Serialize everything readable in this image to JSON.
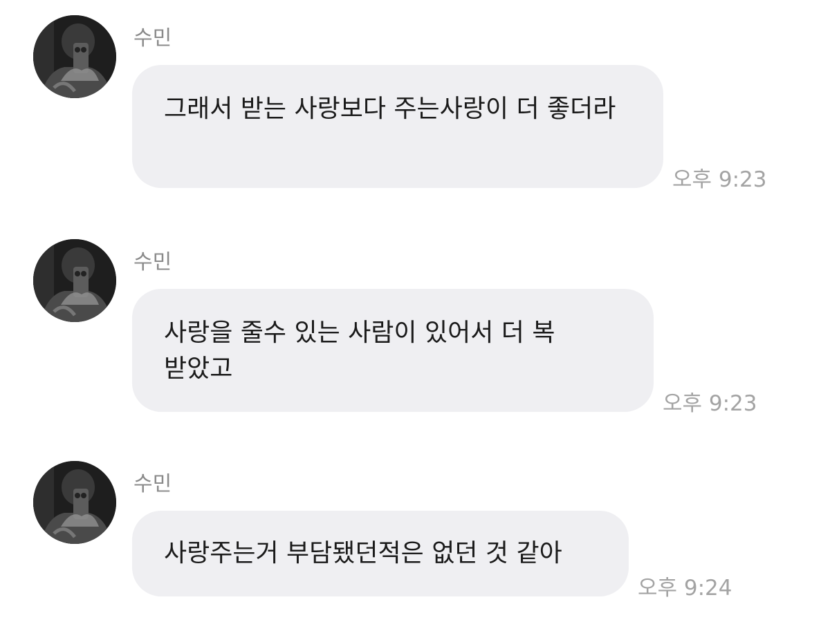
{
  "messages": [
    {
      "sender": "수민",
      "text": "그래서 받는 사랑보다 주는사랑이 더 좋더라",
      "time": "오후 9:23"
    },
    {
      "sender": "수민",
      "text": "사랑을 줄수 있는 사람이 있어서 더 복 받았고",
      "time": "오후 9:23"
    },
    {
      "sender": "수민",
      "text": "사랑주는거 부담됐던적은 없던 것 같아",
      "time": "오후 9:24"
    }
  ],
  "avatar_icon": "profile-photo-icon",
  "colors": {
    "bubble": "#efeff2",
    "sender": "#8a8a8a",
    "time": "#a3a3a3",
    "text": "#1a1a1a"
  }
}
